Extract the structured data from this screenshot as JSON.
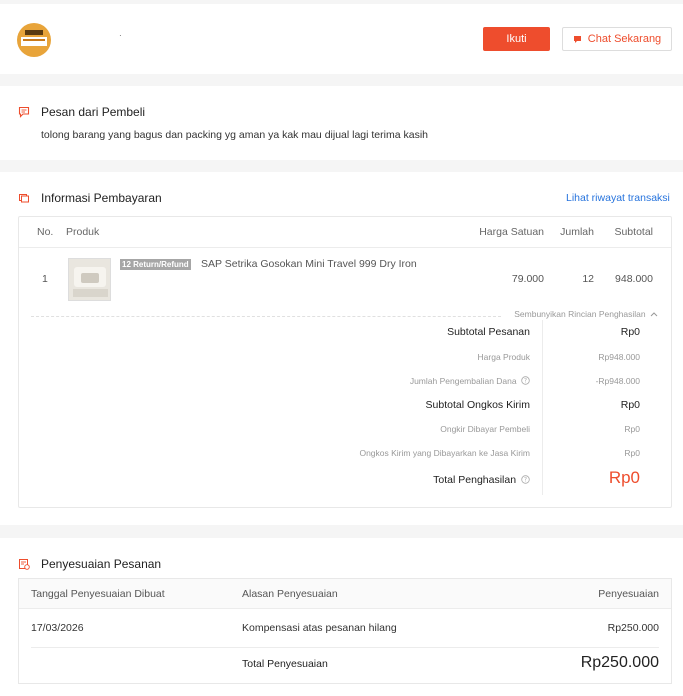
{
  "shop": {
    "name": "",
    "follow_label": "Ikuti",
    "chat_label": "Chat Sekarang"
  },
  "buyer_message": {
    "title": "Pesan dari Pembeli",
    "text": "tolong barang yang bagus dan packing yg aman ya kak mau dijual lagi terima kasih"
  },
  "payment": {
    "title": "Informasi Pembayaran",
    "history_link": "Lihat riwayat transaksi",
    "columns": {
      "no": "No.",
      "product": "Produk",
      "unit_price": "Harga Satuan",
      "qty": "Jumlah",
      "subtotal": "Subtotal"
    },
    "item": {
      "no": "1",
      "badge": "12 Return/Refund",
      "name": "SAP Setrika Gosokan Mini Travel 999 Dry Iron",
      "unit_price": "79.000",
      "qty": "12",
      "subtotal": "948.000"
    },
    "toggle_label": "Sembunyikan Rincian Penghasilan",
    "breakdown": {
      "order_subtotal_label": "Subtotal Pesanan",
      "order_subtotal_value": "Rp0",
      "product_price_label": "Harga Produk",
      "product_price_value": "Rp948.000",
      "refund_label": "Jumlah Pengembalian Dana",
      "refund_value": "-Rp948.000",
      "shipping_subtotal_label": "Subtotal Ongkos Kirim",
      "shipping_subtotal_value": "Rp0",
      "shipping_buyer_label": "Ongkir Dibayar Pembeli",
      "shipping_buyer_value": "Rp0",
      "shipping_courier_label": "Ongkos Kirim yang Dibayarkan ke Jasa Kirim",
      "shipping_courier_value": "Rp0",
      "total_label": "Total Penghasilan",
      "total_value": "Rp0"
    }
  },
  "adjustment": {
    "title": "Penyesuaian Pesanan",
    "columns": {
      "date": "Tanggal Penyesuaian Dibuat",
      "reason": "Alasan Penyesuaian",
      "amount": "Penyesuaian"
    },
    "row": {
      "date": "17/03/2026",
      "reason": "Kompensasi atas pesanan hilang",
      "amount": "Rp250.000"
    },
    "total_label": "Total Penyesuaian",
    "total_value": "Rp250.000"
  },
  "colors": {
    "accent": "#ee4d2d",
    "link": "#2673dd"
  }
}
